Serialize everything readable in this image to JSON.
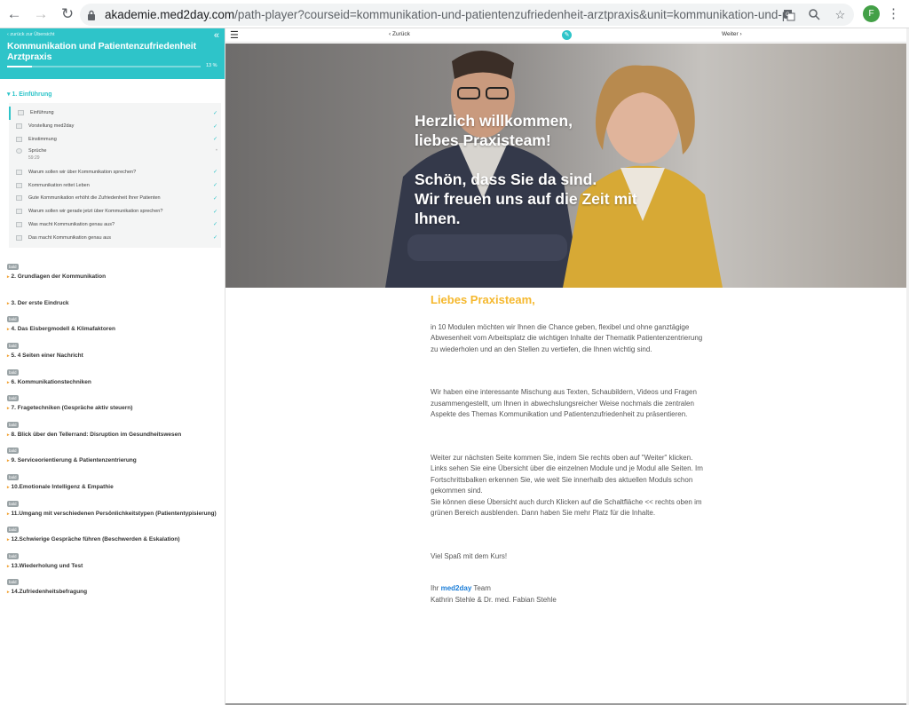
{
  "browser": {
    "url_host": "akademie.med2day.com",
    "url_path": "/path-player?courseid=kommunikation-und-patientenzufriedenheit-arztpraxis&unit=kommunikation-und-patientenzufriedenhei…",
    "profile_initial": "F",
    "icons": [
      "back-arrow-icon",
      "forward-arrow-icon",
      "reload-icon",
      "lock-icon",
      "translate-icon",
      "zoom-icon",
      "star-icon",
      "menu-dots-icon"
    ]
  },
  "sidebar": {
    "back_label": "‹ zurück zur Übersicht",
    "course_title": "Kommunikation und Patientenzufriedenheit Arztpraxis",
    "progress_label": "13 %",
    "progress_value": 0.13,
    "active_module": {
      "title": "1. Einführung",
      "lessons": [
        {
          "label": "Einführung",
          "type": "text",
          "done": true,
          "current": true
        },
        {
          "label": "Vorstellung med2day",
          "type": "text",
          "done": true
        },
        {
          "label": "Einstimmung",
          "type": "text",
          "done": true
        },
        {
          "label": "Sprüche",
          "sub": "59:29",
          "type": "video",
          "done": false
        },
        {
          "label": "Warum sollen wir über Kommunikation sprechen?",
          "type": "text",
          "done": true
        },
        {
          "label": "Kommunikation rettet Leben",
          "type": "text",
          "done": true
        },
        {
          "label": "Gute Kommunikation erhöht die Zufriedenheit Ihrer Patienten",
          "type": "text",
          "done": true
        },
        {
          "label": "Warum sollen wir gerade jetzt über Kommunikation sprechen?",
          "type": "text",
          "done": true
        },
        {
          "label": "Was macht Kommunikation genau aus?",
          "type": "text",
          "done": true
        },
        {
          "label": "Das macht Kommunikation genau aus",
          "type": "text",
          "done": true
        }
      ]
    },
    "modules": [
      {
        "badge": "bald",
        "title": "2. Grundlagen der Kommunikation"
      },
      {
        "badge": "",
        "title": "3. Der erste Eindruck"
      },
      {
        "badge": "bald",
        "title": "4. Das Eisbergmodell & Klimafaktoren"
      },
      {
        "badge": "bald",
        "title": "5. 4 Seiten einer Nachricht"
      },
      {
        "badge": "bald",
        "title": "6. Kommunikationstechniken"
      },
      {
        "badge": "bald",
        "title": "7. Fragetechniken (Gespräche aktiv steuern)"
      },
      {
        "badge": "bald",
        "title": "8. Blick über den Tellerrand: Disruption im Gesundheitswesen"
      },
      {
        "badge": "bald",
        "title": "9. Serviceorientierung & Patientenzentrierung"
      },
      {
        "badge": "bald",
        "title": "10.Emotionale Intelligenz & Empathie"
      },
      {
        "badge": "bald",
        "title": "11.Umgang mit verschiedenen Persönlichkeitstypen (Patiententypisierung)"
      },
      {
        "badge": "bald",
        "title": "12.Schwierige Gespräche führen (Beschwerden & Eskalation)"
      },
      {
        "badge": "bald",
        "title": "13.Wiederholung und Test"
      },
      {
        "badge": "bald",
        "title": "14.Zufriedenheitsbefragung"
      }
    ]
  },
  "topbar": {
    "prev_label": "‹ Zurück",
    "next_label": "Weiter ›"
  },
  "hero": {
    "line1": "Herzlich willkommen,",
    "line2": "liebes Praxisteam!",
    "line3": "Schön, dass Sie da sind.",
    "line4": "Wir freuen uns auf die Zeit mit",
    "line5": "Ihnen."
  },
  "letter": {
    "greeting": "Liebes Praxisteam,",
    "p1": "in 10 Modulen möchten wir Ihnen die Chance geben, flexibel und ohne ganztägige Abwesenheit vom Arbeitsplatz die wichtigen Inhalte der Thematik Patientenzentrierung zu wiederholen und an den Stellen zu vertiefen, die Ihnen wichtig sind.",
    "p2": "Wir haben eine interessante Mischung aus Texten, Schaubildern, Videos und Fragen zusammengestellt, um Ihnen in abwechslungsreicher Weise nochmals die zentralen Aspekte des Themas Kommunikation und Patientenzufriedenheit zu präsentieren.",
    "p3a": "Weiter zur nächsten Seite kommen Sie, indem Sie rechts oben auf \"Weiter\" klicken.",
    "p3b": "Links sehen Sie eine Übersicht über die einzelnen Module und je Modul alle Seiten. Im Fortschrittsbalken erkennen Sie, wie weit Sie innerhalb des aktuellen Moduls schon gekommen sind.",
    "p3c": "Sie können diese Übersicht auch durch Klicken auf die Schaltfläche << rechts oben im grünen Bereich ausblenden. Dann haben Sie mehr Platz für die Inhalte.",
    "p4": "Viel Spaß mit dem Kurs!",
    "sign_prefix": "Ihr",
    "sign_brand": "med2day",
    "sign_suffix": "Team",
    "sign_names": "Kathrin Stehle & Dr. med. Fabian Stehle"
  },
  "colors": {
    "accent_teal": "#2ec4c9",
    "greeting_yellow": "#f5b82e",
    "brand_blue": "#1a7dd8"
  }
}
